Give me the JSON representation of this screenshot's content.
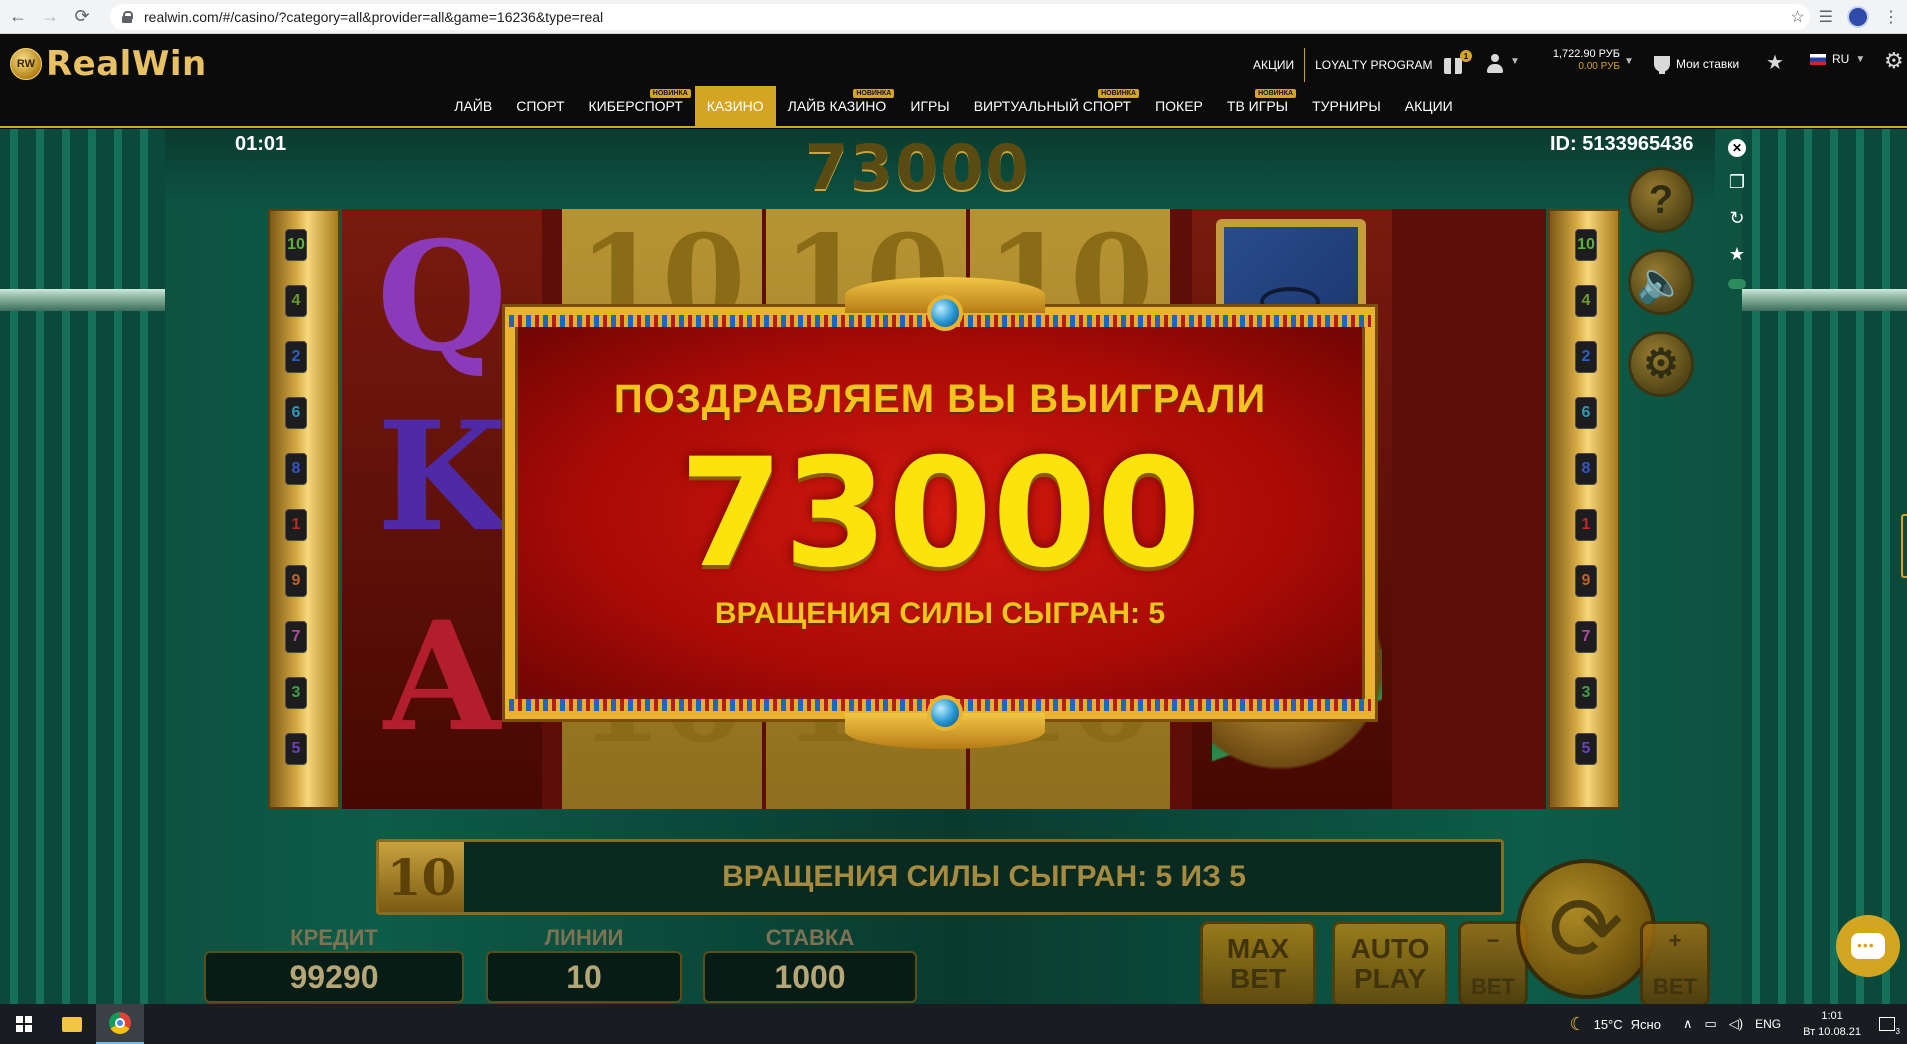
{
  "browser": {
    "url": "realwin.com/#/casino/?category=all&provider=all&game=16236&type=real",
    "back": "←",
    "forward": "→",
    "reload": "⟳",
    "bookmark": "☆",
    "reading_list": "☰",
    "menu": "⋮"
  },
  "site": {
    "logo_badge": "RW",
    "logo_text": "RealWin",
    "header_links": [
      "АКЦИИ",
      "LOYALTY PROGRAM"
    ],
    "gift_count": "1",
    "balance_main": "1,722.90 РУБ",
    "balance_bonus": "0.00 РУБ",
    "bets_label": "Мои ставки",
    "lang": "RU",
    "nav": [
      {
        "label": "ЛАЙВ",
        "badge": ""
      },
      {
        "label": "СПОРТ",
        "badge": ""
      },
      {
        "label": "КИБЕРСПОРТ",
        "badge": "НОВИНКА"
      },
      {
        "label": "КАЗИНО",
        "badge": ""
      },
      {
        "label": "ЛАЙВ КАЗИНО",
        "badge": "НОВИНКА"
      },
      {
        "label": "ИГРЫ",
        "badge": ""
      },
      {
        "label": "ВИРТУАЛЬНЫЙ СПОРТ",
        "badge": "НОВИНКА"
      },
      {
        "label": "ПОКЕР",
        "badge": ""
      },
      {
        "label": "ТВ ИГРЫ",
        "badge": "НОВИНКА"
      },
      {
        "label": "ТУРНИРЫ",
        "badge": ""
      },
      {
        "label": "АКЦИИ",
        "badge": ""
      }
    ],
    "active_nav": "КАЗИНО",
    "accent_color": "#d4a521"
  },
  "game": {
    "timer": "01:01",
    "game_id": "ID: 5133965436",
    "top_jackpot": "73000",
    "line_numbers_left": [
      "10",
      "4",
      "2",
      "6",
      "8",
      "1",
      "9",
      "7",
      "3",
      "5"
    ],
    "line_numbers_right": [
      "10",
      "4",
      "2",
      "6",
      "8",
      "1",
      "9",
      "7",
      "3",
      "5"
    ],
    "reel_symbols": {
      "q": "Q",
      "k": "K",
      "a": "A",
      "ten": "10"
    },
    "win_modal": {
      "title": "ПОЗДРАВЛЯЕМ ВЫ ВЫИГРАЛИ",
      "amount": "73000",
      "subtitle": "ВРАЩЕНИЯ СИЛЫ СЫГРАН: 5"
    },
    "status_bar": "ВРАЩЕНИЯ СИЛЫ СЫГРАН: 5 ИЗ 5",
    "status_symbol": "10",
    "credit_label": "КРЕДИТ",
    "credit_value": "99290",
    "lines_label": "ЛИНИИ",
    "lines_value": "10",
    "bet_label": "СТАВКА",
    "bet_value": "1000",
    "max_bet": [
      "MAX",
      "BET"
    ],
    "auto_play": [
      "AUTO",
      "PLAY"
    ],
    "bet_minus": "BET",
    "bet_plus": "BET",
    "help_glyph": "?",
    "sound_glyph": "🔈",
    "settings_glyph": "⚙"
  },
  "taskbar": {
    "weather_temp": "15°C",
    "weather_text": "Ясно",
    "input_lang": "ENG",
    "time": "1:01",
    "date": "Вт 10.08.21",
    "notif_count": "3"
  }
}
